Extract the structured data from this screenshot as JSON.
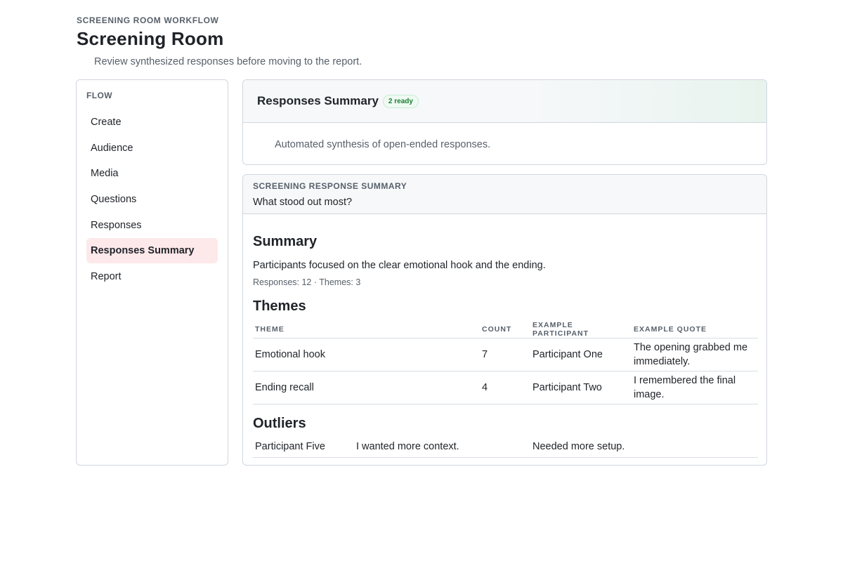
{
  "header": {
    "eyebrow": "SCREENING ROOM WORKFLOW",
    "title": "Screening Room",
    "subtitle": "Review synthesized responses before moving to the report."
  },
  "sidebar": {
    "label": "FLOW",
    "items": [
      {
        "label": "Create",
        "active": false
      },
      {
        "label": "Audience",
        "active": false
      },
      {
        "label": "Media",
        "active": false
      },
      {
        "label": "Questions",
        "active": false
      },
      {
        "label": "Responses",
        "active": false
      },
      {
        "label": "Responses Summary",
        "active": true
      },
      {
        "label": "Report",
        "active": false
      }
    ]
  },
  "summary_card": {
    "title": "Responses Summary",
    "badge": "2 ready",
    "description": "Automated synthesis of open-ended responses."
  },
  "response_card": {
    "eyebrow": "SCREENING RESPONSE SUMMARY",
    "question": "What stood out most?",
    "summary_heading": "Summary",
    "summary_text": "Participants focused on the clear emotional hook and the ending.",
    "meta": "Responses: 12 · Themes: 3",
    "themes_heading": "Themes",
    "themes_columns": [
      "THEME",
      "COUNT",
      "EXAMPLE PARTICIPANT",
      "EXAMPLE QUOTE"
    ],
    "themes_rows": [
      {
        "theme": "Emotional hook",
        "count": "7",
        "participant": "Participant One",
        "quote": "The opening grabbed me immediately."
      },
      {
        "theme": "Ending recall",
        "count": "4",
        "participant": "Participant Two",
        "quote": "I remembered the final image."
      }
    ],
    "outliers_heading": "Outliers",
    "outliers_rows": [
      {
        "participant": "Participant Five",
        "response": "I wanted more context.",
        "note": "Needed more setup."
      }
    ]
  },
  "colors": {
    "active_nav_bg": "#fde8ea",
    "ready_badge": "#1a7f37",
    "border": "#d0d7de"
  }
}
